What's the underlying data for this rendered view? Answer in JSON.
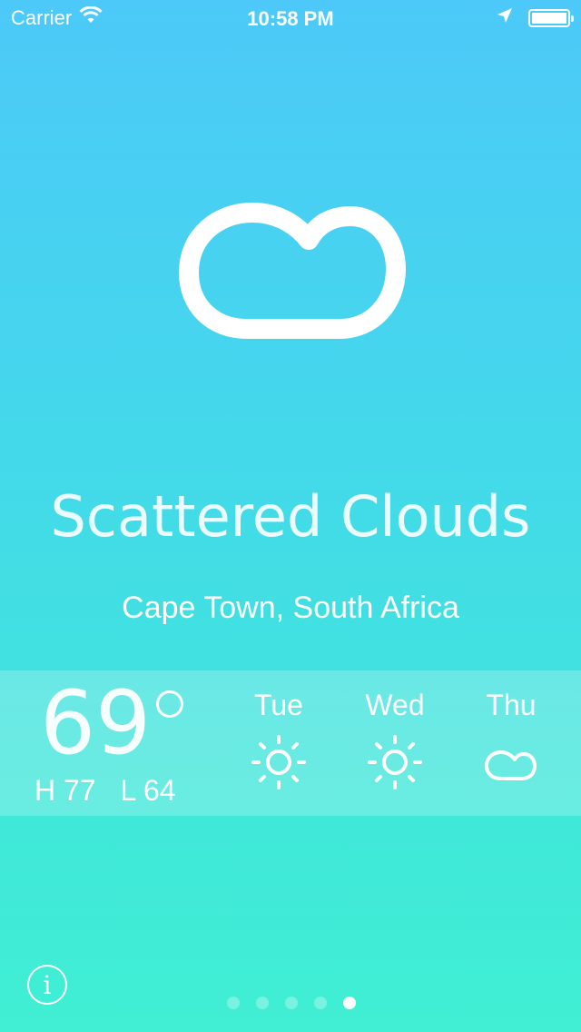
{
  "status_bar": {
    "carrier": "Carrier",
    "time": "10:58 PM",
    "wifi_icon": "wifi-icon",
    "location_icon": "location-arrow-icon",
    "battery_icon": "battery-icon"
  },
  "weather": {
    "main_icon": "cloud-icon",
    "condition": "Scattered Clouds",
    "location": "Cape Town, South Africa",
    "current_temp": "69",
    "high": "H 77",
    "low": "L 64"
  },
  "forecast": [
    {
      "day": "Tue",
      "icon": "sun-icon"
    },
    {
      "day": "Wed",
      "icon": "sun-icon"
    },
    {
      "day": "Thu",
      "icon": "cloud-icon"
    }
  ],
  "footer": {
    "info_label": "i",
    "page_count": 5,
    "active_page": 5
  },
  "colors": {
    "gradient_top": "#4cc9f8",
    "gradient_bottom": "#40efd4",
    "text": "#ffffff"
  }
}
